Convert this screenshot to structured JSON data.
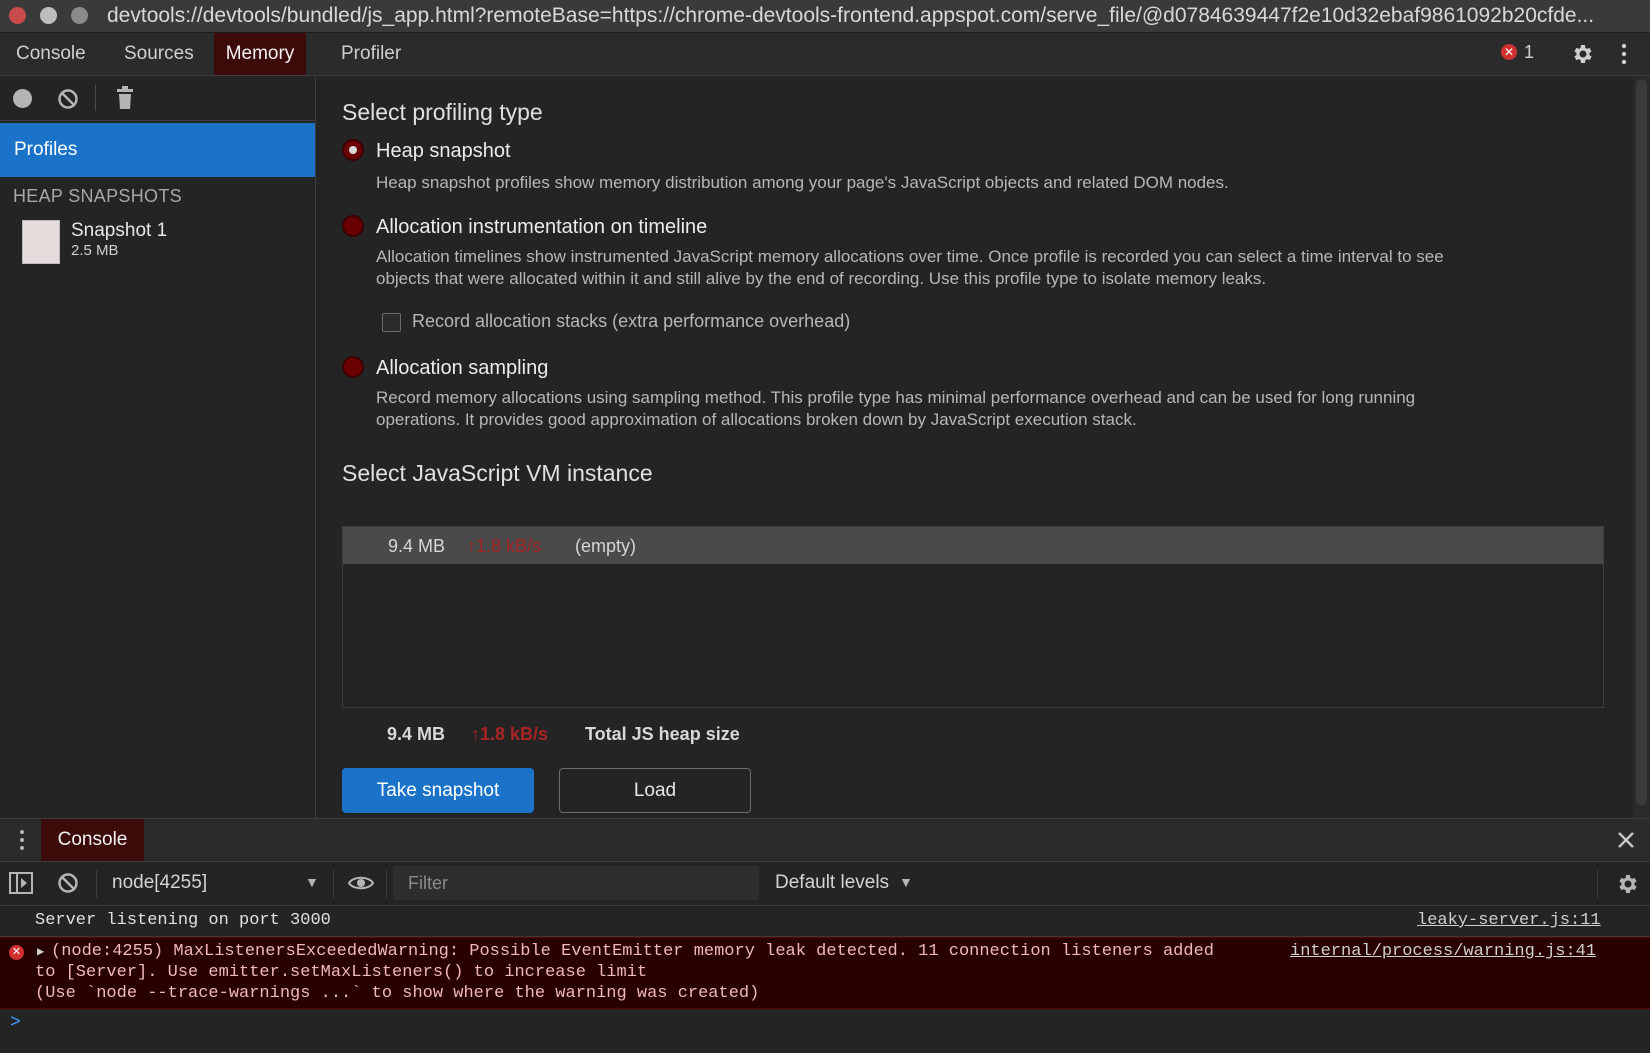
{
  "window": {
    "url": "devtools://devtools/bundled/js_app.html?remoteBase=https://chrome-devtools-frontend.appspot.com/serve_file/@d0784639447f2e10d32ebaf9861092b20cfde..."
  },
  "tabs": [
    {
      "label": "Console",
      "active": false
    },
    {
      "label": "Sources",
      "active": false
    },
    {
      "label": "Memory",
      "active": true
    },
    {
      "label": "Profiler",
      "active": false
    }
  ],
  "header": {
    "error_count": "1"
  },
  "sidebar": {
    "profiles_label": "Profiles",
    "section_title": "HEAP SNAPSHOTS",
    "snapshots": [
      {
        "name": "Snapshot 1",
        "size": "2.5 MB"
      }
    ]
  },
  "profiling": {
    "title": "Select profiling type",
    "options": [
      {
        "label": "Heap snapshot",
        "checked": true,
        "description": "Heap snapshot profiles show memory distribution among your page's JavaScript objects and related DOM nodes."
      },
      {
        "label": "Allocation instrumentation on timeline",
        "checked": false,
        "description_line1": "Allocation timelines show instrumented JavaScript memory allocations over time. Once profile is recorded you can select a time interval to see",
        "description_line2": "objects that were allocated within it and still alive by the end of recording. Use this profile type to isolate memory leaks."
      },
      {
        "label": "Allocation sampling",
        "checked": false,
        "description_line1": "Record memory allocations using sampling method. This profile type has minimal performance overhead and can be used for long running",
        "description_line2": "operations. It provides good approximation of allocations broken down by JavaScript execution stack."
      }
    ],
    "record_stacks_label": "Record allocation stacks (extra performance overhead)"
  },
  "vm": {
    "title": "Select JavaScript VM instance",
    "instances": [
      {
        "size": "9.4 MB",
        "rate": "↑1.8 kB/s",
        "name": "(empty)"
      }
    ],
    "total_size": "9.4 MB",
    "total_rate": "↑1.8 kB/s",
    "total_label": "Total JS heap size"
  },
  "buttons": {
    "take_snapshot": "Take snapshot",
    "load": "Load"
  },
  "drawer": {
    "tab": "Console",
    "context": "node[4255]",
    "filter_placeholder": "Filter",
    "levels": "Default levels"
  },
  "console": {
    "messages": [
      {
        "type": "log",
        "text": "Server listening on port 3000",
        "source": "leaky-server.js:11"
      },
      {
        "type": "error",
        "line1": "(node:4255) MaxListenersExceededWarning: Possible EventEmitter memory leak detected. 11 connection listeners added",
        "line2": "to [Server]. Use emitter.setMaxListeners() to increase limit",
        "line3": "(Use `node --trace-warnings ...` to show where the warning was created)",
        "source": "internal/process/warning.js:41"
      }
    ],
    "prompt": ">"
  },
  "colors": {
    "accent": "#1a73c9",
    "active_tab": "#3d0a0a",
    "error_bg": "#290000",
    "rate_red": "#a82424"
  }
}
